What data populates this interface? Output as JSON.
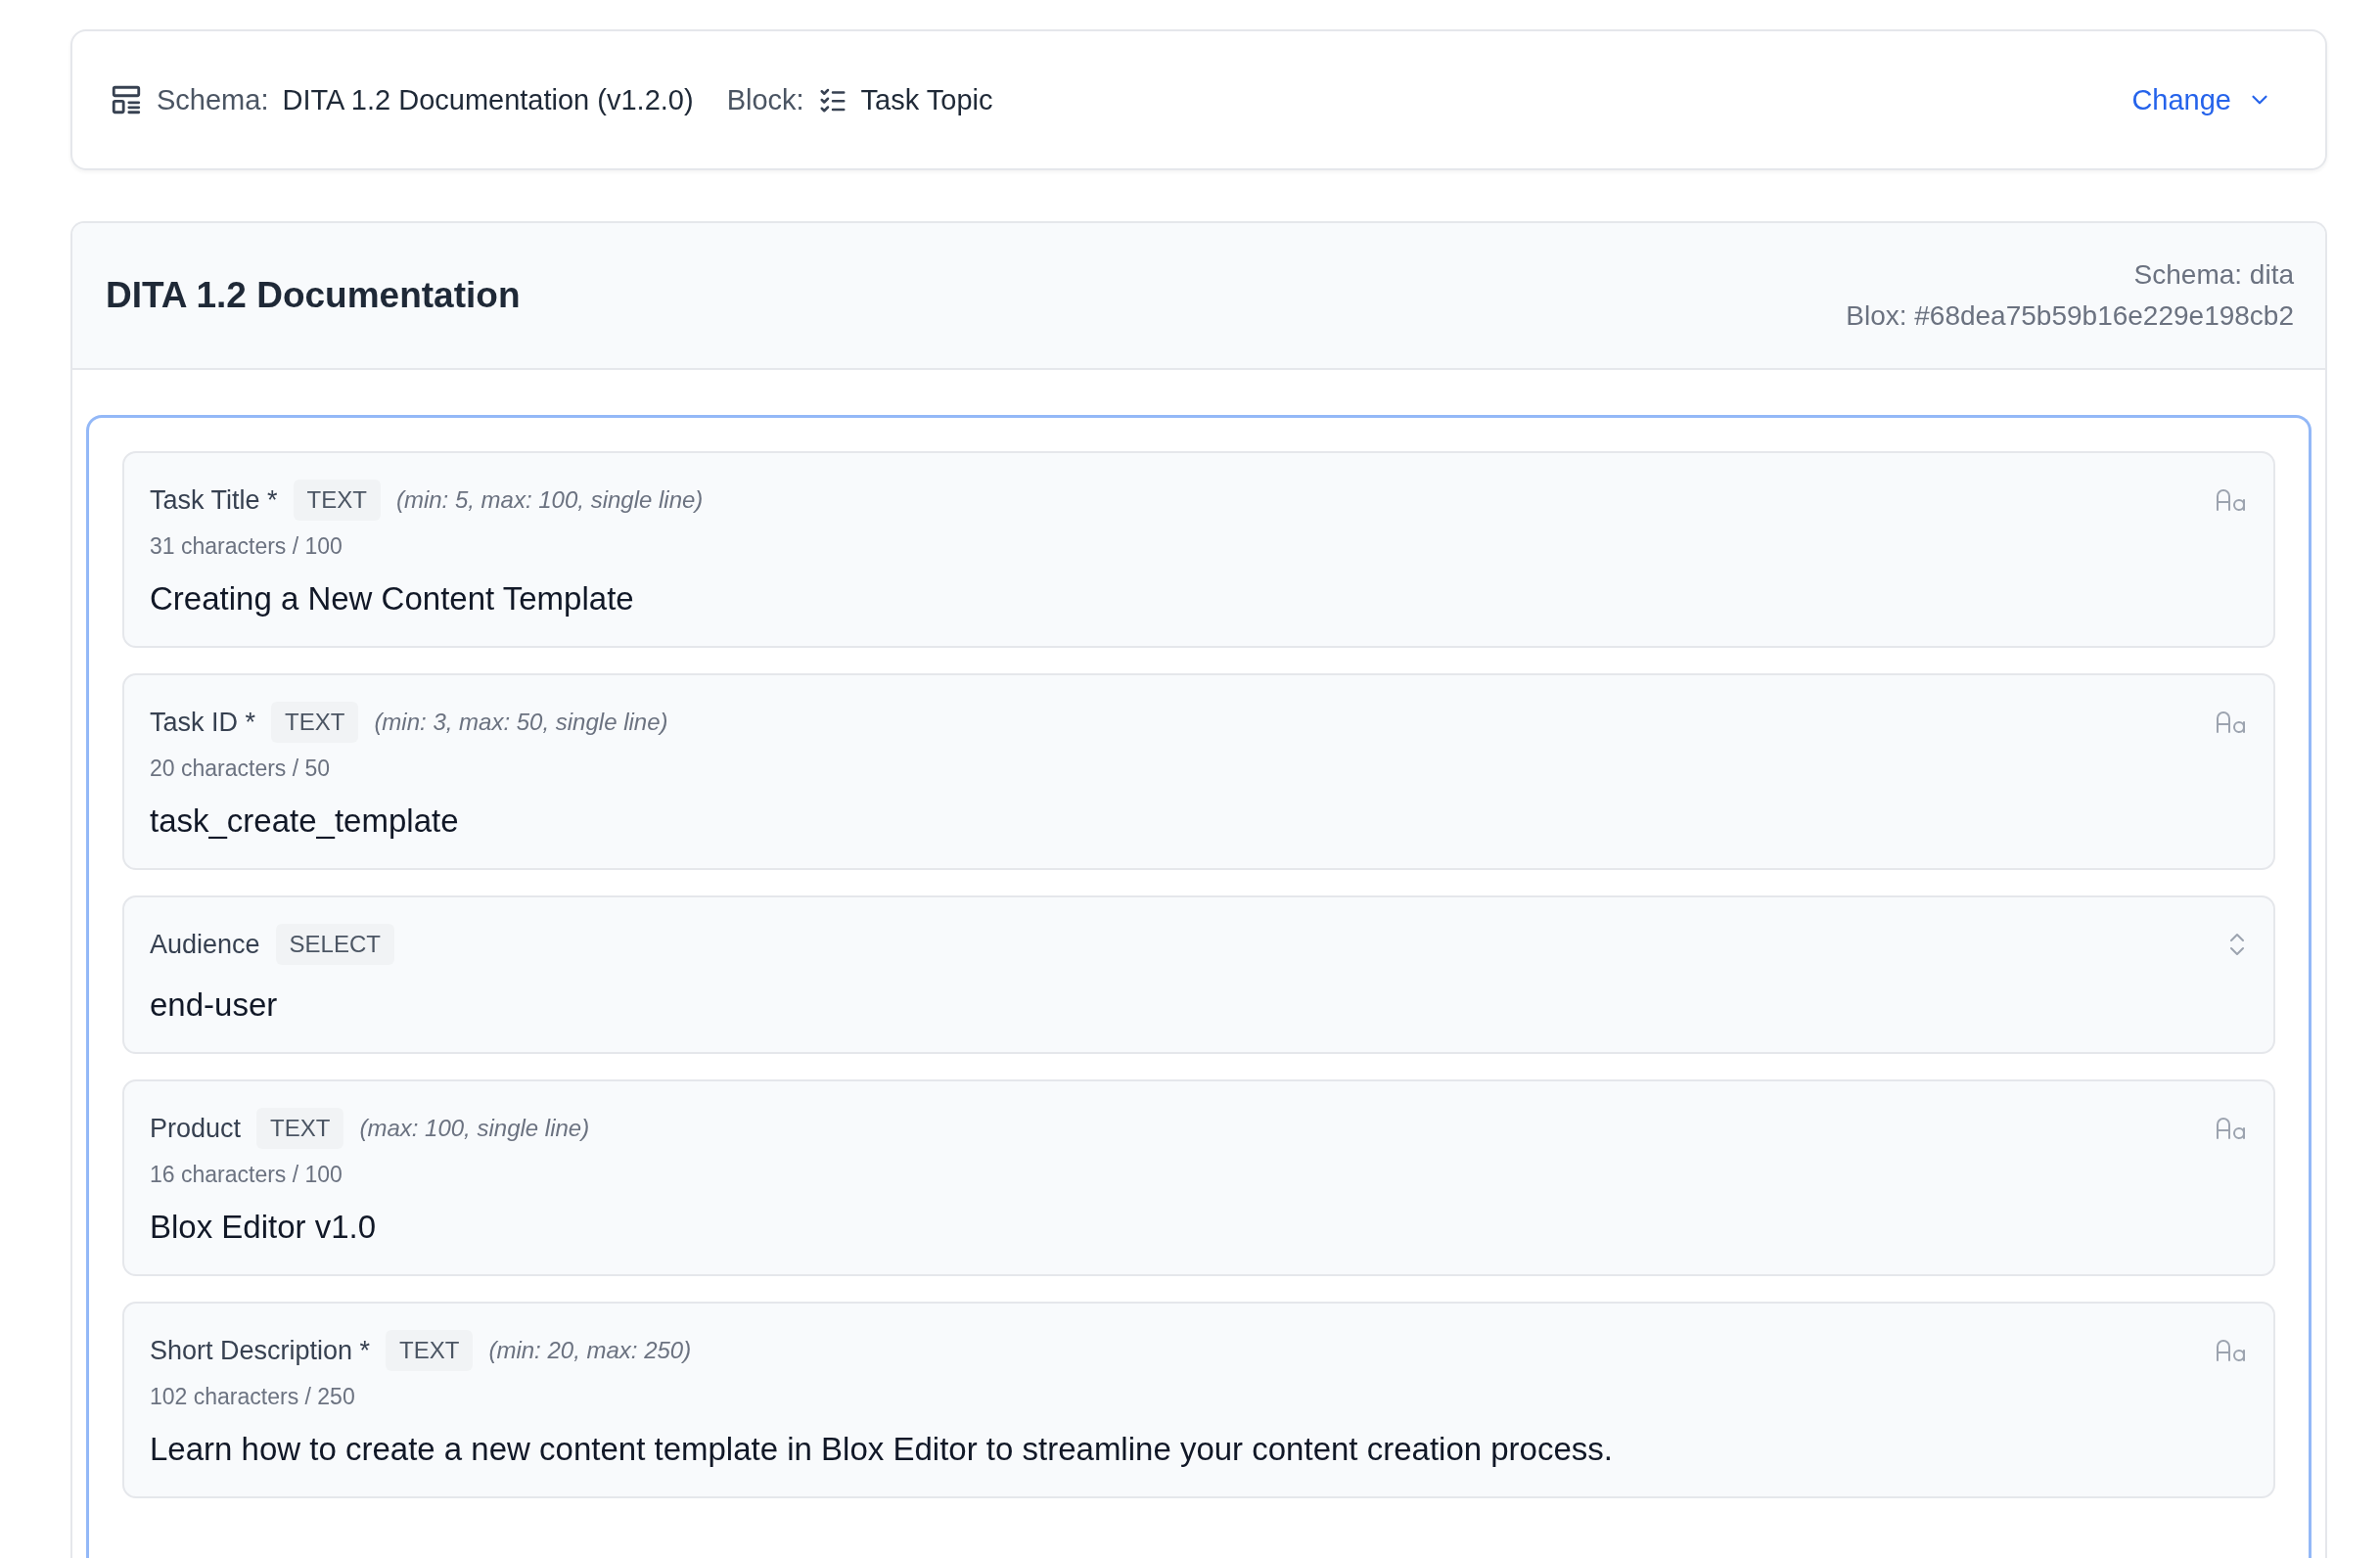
{
  "selector_bar": {
    "schema_label": "Schema:",
    "schema_value": "DITA 1.2 Documentation (v1.2.0)",
    "block_label": "Block:",
    "block_value": "Task Topic",
    "change_button": "Change"
  },
  "panel": {
    "title": "DITA 1.2 Documentation",
    "schema_info": "Schema: dita",
    "blox_info": "Blox: #68dea75b59b16e229e198cb2",
    "fields": [
      {
        "kind": "text",
        "label": "Task Title *",
        "type": "TEXT",
        "constraints": "(min: 5, max: 100, single line)",
        "count": "31 characters / 100",
        "value": "Creating a New Content Template"
      },
      {
        "kind": "text",
        "label": "Task ID *",
        "type": "TEXT",
        "constraints": "(min: 3, max: 50, single line)",
        "count": "20 characters / 50",
        "value": "task_create_template"
      },
      {
        "kind": "select",
        "label": "Audience",
        "type": "SELECT",
        "value": "end-user"
      },
      {
        "kind": "text",
        "label": "Product",
        "type": "TEXT",
        "constraints": "(max: 100, single line)",
        "count": "16 characters / 100",
        "value": "Blox Editor v1.0"
      },
      {
        "kind": "text",
        "label": "Short Description *",
        "type": "TEXT",
        "constraints": "(min: 20, max: 250)",
        "count": "102 characters / 250",
        "value": "Learn how to create a new content template in Blox Editor to streamline your content creation process."
      }
    ]
  }
}
